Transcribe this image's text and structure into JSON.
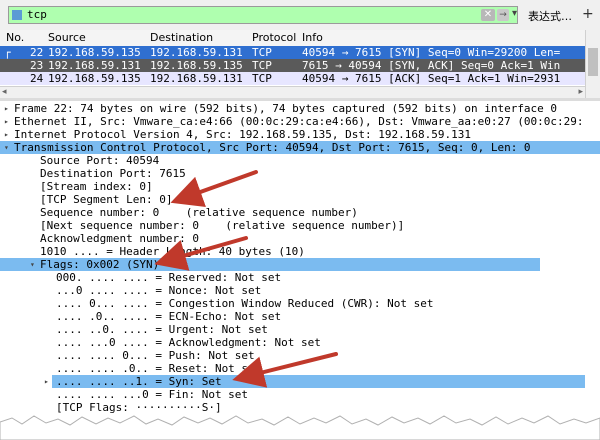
{
  "filter": {
    "value": "tcp",
    "clear_glyph": "✕",
    "apply_glyph": "→",
    "dropdown_glyph": "▾",
    "expression_label": "表达式…",
    "add_label": "+"
  },
  "packet_list": {
    "columns": {
      "no": "No.",
      "source": "Source",
      "destination": "Destination",
      "protocol": "Protocol",
      "info": "Info"
    },
    "rows": [
      {
        "no": "22",
        "source": "192.168.59.135",
        "destination": "192.168.59.131",
        "protocol": "TCP",
        "info": "40594 → 7615 [SYN] Seq=0 Win=29200 Len="
      },
      {
        "no": "23",
        "source": "192.168.59.131",
        "destination": "192.168.59.135",
        "protocol": "TCP",
        "info": "7615 → 40594 [SYN, ACK] Seq=0 Ack=1 Win"
      },
      {
        "no": "24",
        "source": "192.168.59.135",
        "destination": "192.168.59.131",
        "protocol": "TCP",
        "info": "40594 → 7615 [ACK] Seq=1 Ack=1 Win=2931"
      }
    ],
    "hscroll_left": "◂",
    "hscroll_right": "▸"
  },
  "details": {
    "frame": "Frame 22: 74 bytes on wire (592 bits), 74 bytes captured (592 bits) on interface 0",
    "ethernet": "Ethernet II, Src: Vmware_ca:e4:66 (00:0c:29:ca:e4:66), Dst: Vmware_aa:e0:27 (00:0c:29:",
    "ip": "Internet Protocol Version 4, Src: 192.168.59.135, Dst: 192.168.59.131",
    "tcp": "Transmission Control Protocol, Src Port: 40594, Dst Port: 7615, Seq: 0, Len: 0",
    "src_port": "Source Port: 40594",
    "dst_port": "Destination Port: 7615",
    "stream_index": "[Stream index: 0]",
    "seg_len": "[TCP Segment Len: 0]",
    "seq": "Sequence number: 0    (relative sequence number)",
    "next_seq": "[Next sequence number: 0    (relative sequence number)]",
    "ack": "Acknowledgment number: 0",
    "header_len": "1010 .... = Header Length: 40 bytes (10)",
    "flags": "Flags: 0x002 (SYN)",
    "reserved": "000. .... .... = Reserved: Not set",
    "nonce": "...0 .... .... = Nonce: Not set",
    "cwr": ".... 0... .... = Congestion Window Reduced (CWR): Not set",
    "ecn": ".... .0.. .... = ECN-Echo: Not set",
    "urgent": ".... ..0. .... = Urgent: Not set",
    "ackflag": ".... ...0 .... = Acknowledgment: Not set",
    "push": ".... .... 0... = Push: Not set",
    "reset": ".... .... .0.. = Reset: Not set",
    "syn": ".... .... ..1. = Syn: Set",
    "fin": ".... .... ...0 = Fin: Not set",
    "tcp_flags": "[TCP Flags: ··········S·]"
  },
  "glyphs": {
    "collapsed": "▸",
    "expanded": "▾"
  },
  "colors": {
    "filter_ok": "#afffaf",
    "selected_row": "#2f6fd0",
    "selected_detail": "#7bbbf0",
    "annotation_arrow": "#c0392b"
  }
}
